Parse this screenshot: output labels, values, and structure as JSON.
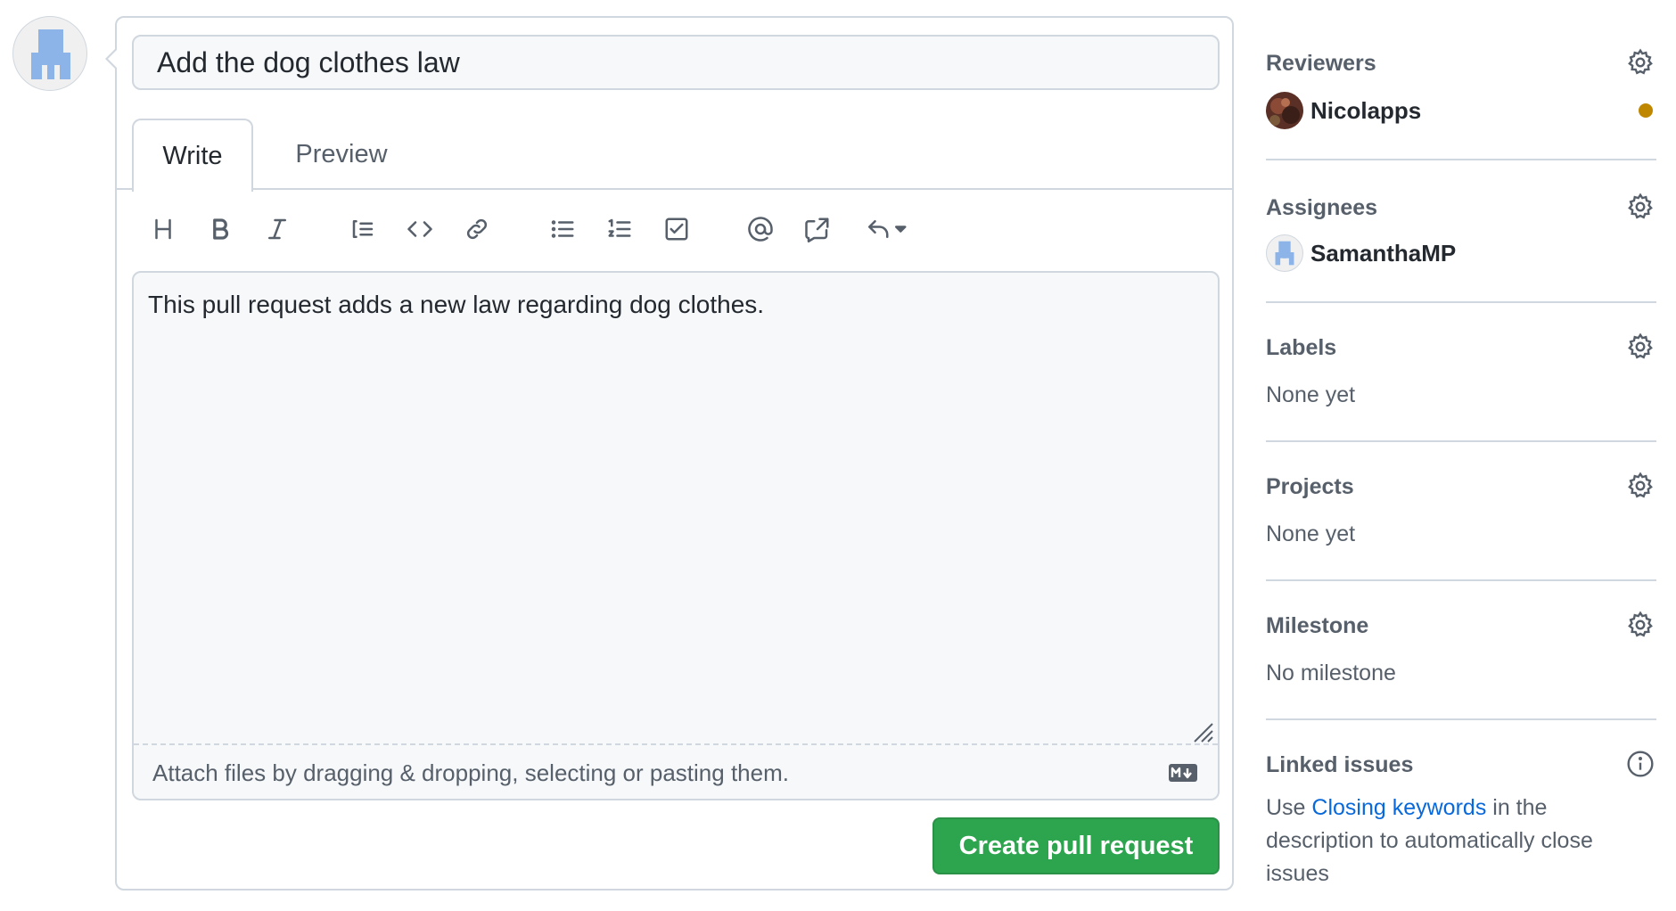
{
  "pull_request": {
    "title": "Add the dog clothes law",
    "tabs": [
      {
        "label": "Write",
        "active": true
      },
      {
        "label": "Preview",
        "active": false
      }
    ],
    "toolbar_icons": [
      "heading-icon",
      "bold-icon",
      "italic-icon",
      "quote-icon",
      "code-icon",
      "link-icon",
      "unordered-list-icon",
      "ordered-list-icon",
      "task-list-icon",
      "mention-icon",
      "cross-reference-icon",
      "saved-reply-icon"
    ],
    "body": "This pull request adds a new law regarding dog clothes.",
    "attach_hint": "Attach files by dragging & dropping, selecting or pasting them.",
    "markdown_badge": "M↓",
    "submit_label": "Create pull request"
  },
  "sidebar": {
    "reviewers": {
      "heading": "Reviewers",
      "people": [
        {
          "name": "Nicolapps",
          "status": "pending",
          "status_color": "#bf8700"
        }
      ]
    },
    "assignees": {
      "heading": "Assignees",
      "people": [
        {
          "name": "SamanthaMP"
        }
      ]
    },
    "labels": {
      "heading": "Labels",
      "value": "None yet"
    },
    "projects": {
      "heading": "Projects",
      "value": "None yet"
    },
    "milestone": {
      "heading": "Milestone",
      "value": "No milestone"
    },
    "linked_issues": {
      "heading": "Linked issues",
      "text_before": "Use ",
      "link": "Closing keywords",
      "text_after": " in the description to automatically close issues"
    }
  },
  "colors": {
    "primary_button": "#2da44e",
    "link": "#0969da",
    "border": "#d0d7de",
    "muted_text": "#57606a",
    "avatar_identicon": "#8cb4e8"
  }
}
